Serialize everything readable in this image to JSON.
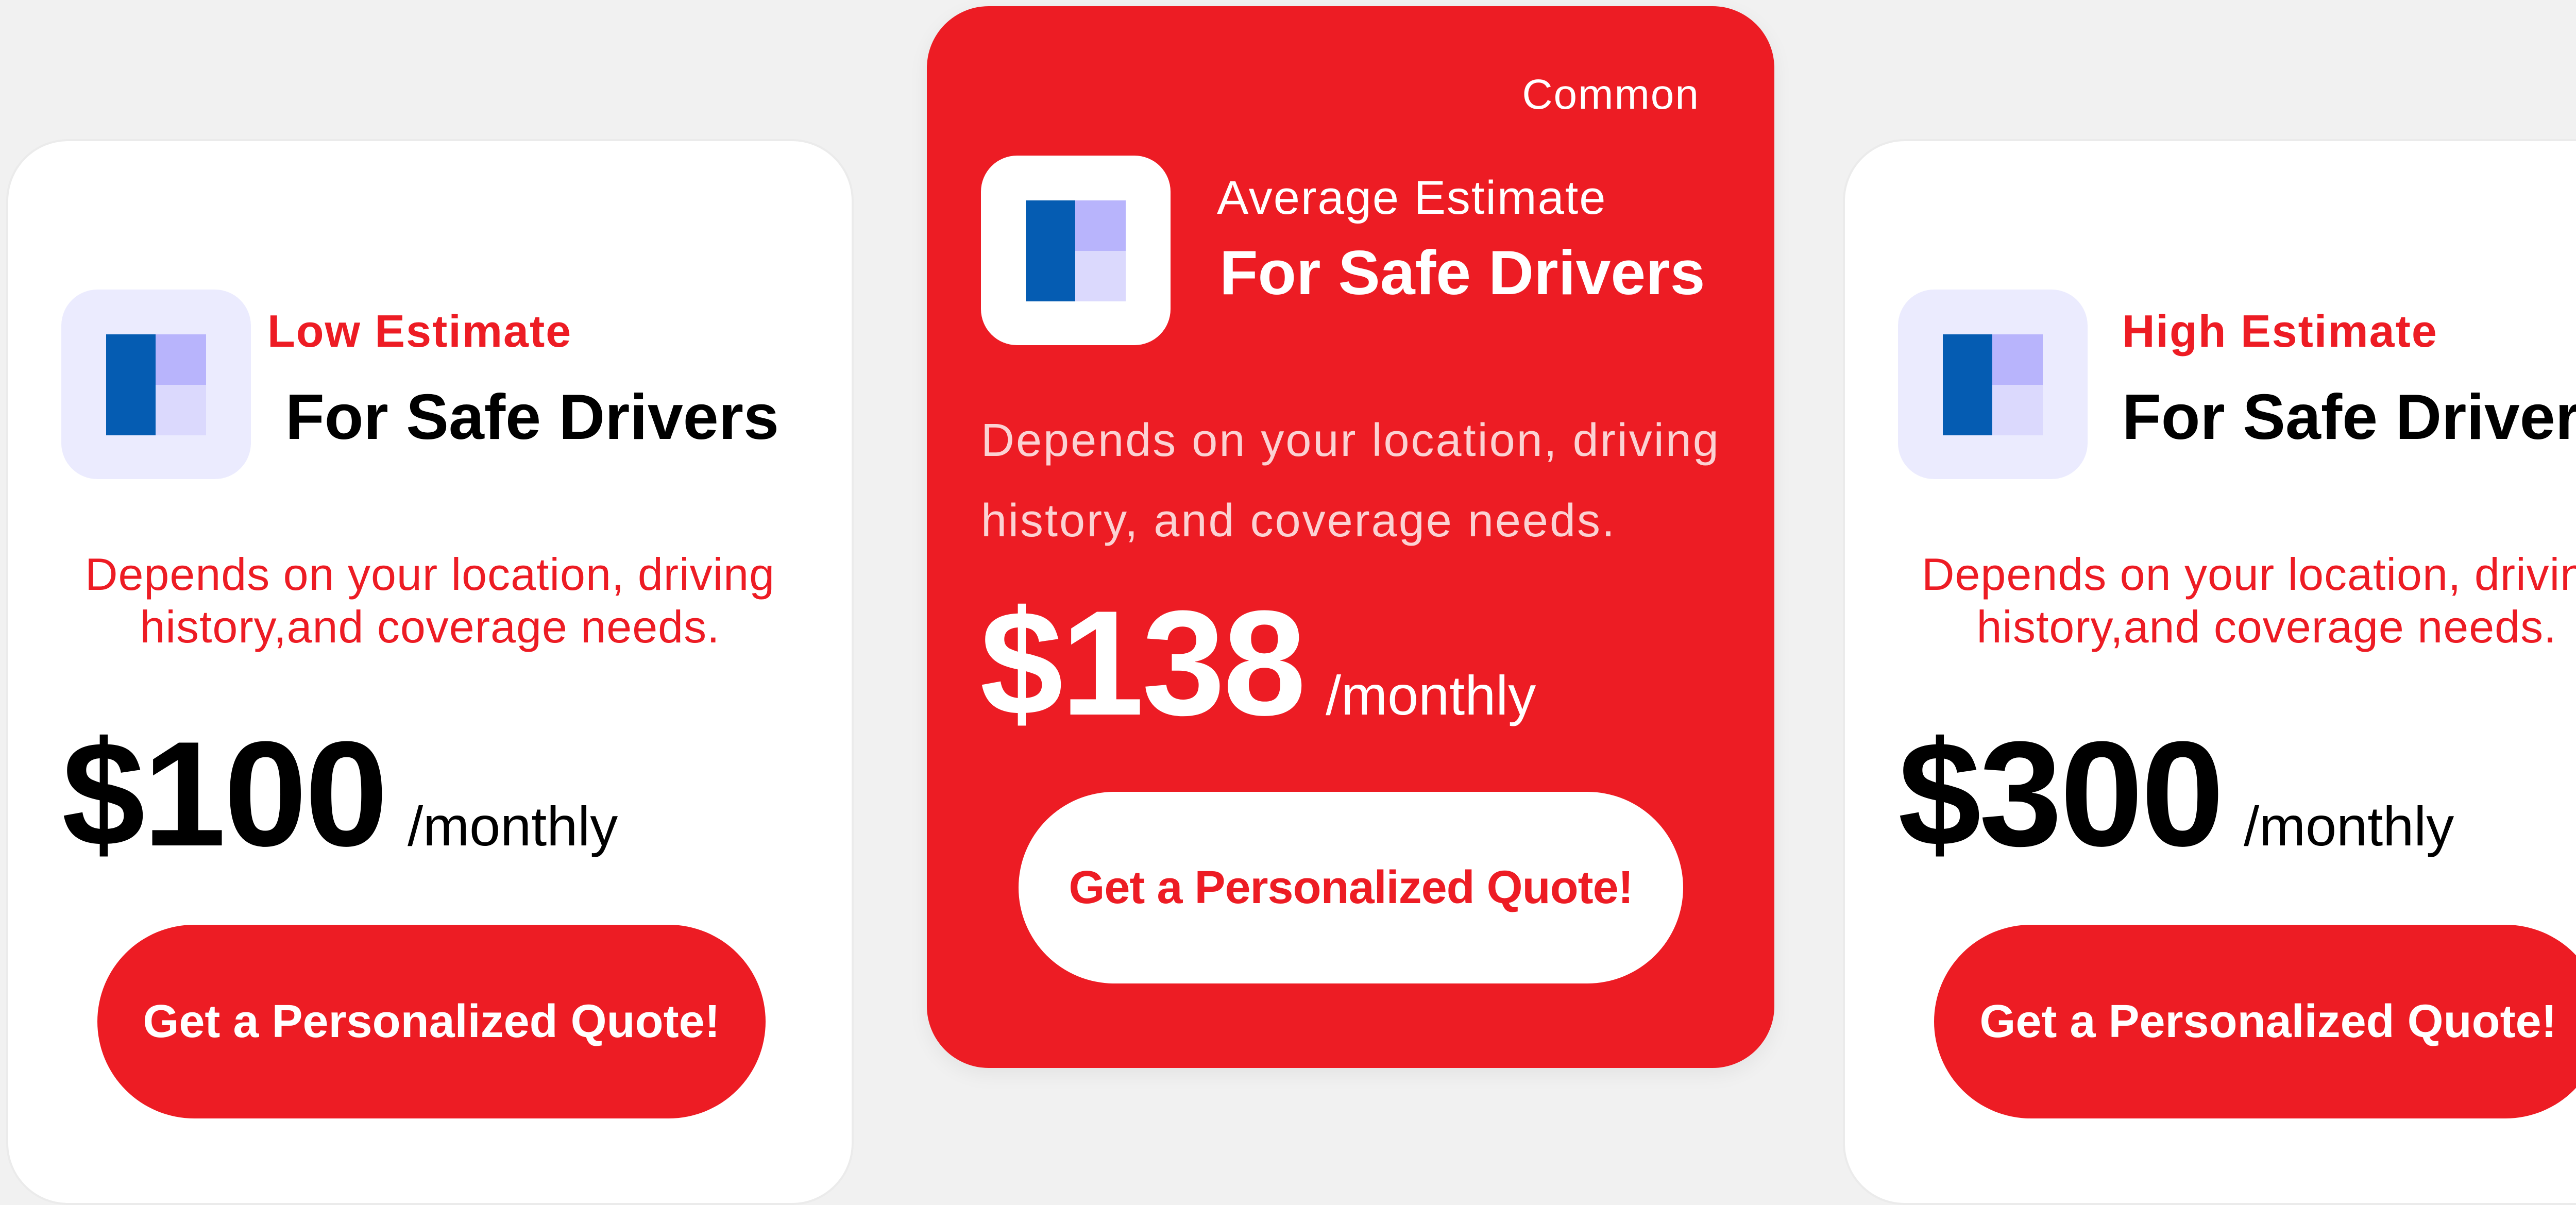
{
  "plans": {
    "low": {
      "estimate_label": "Low Estimate",
      "subhead": "For Safe Drivers",
      "description_line1": "Depends on your location, driving",
      "description_line2": "history,and coverage needs.",
      "price": "$100",
      "period": "/monthly",
      "cta_label": "Get a Personalized Quote!",
      "icon": "layout-icon"
    },
    "average": {
      "badge": "Common",
      "estimate_label": "Average Estimate",
      "subhead": "For Safe Drivers",
      "description_line1": "Depends on your location, driving",
      "description_line2": "history, and coverage needs.",
      "price": "$138",
      "period": "/monthly",
      "cta_label": "Get a Personalized Quote!",
      "icon": "layout-icon"
    },
    "high": {
      "estimate_label": "High Estimate",
      "subhead": "For Safe Drivers",
      "description_line1": "Depends on your location, driving",
      "description_line2": "history,and coverage needs.",
      "price": "$300",
      "period": "/monthly",
      "cta_label": "Get a Personalized Quote!",
      "icon": "layout-icon"
    }
  },
  "colors": {
    "accent_red": "#ed1c24",
    "icon_blue": "#055cb2",
    "icon_lavender": "#b8b4fc",
    "icon_lavender_light": "#dbd9fd",
    "icon_bg": "#ebebfe",
    "page_bg": "#f1f1f1"
  }
}
